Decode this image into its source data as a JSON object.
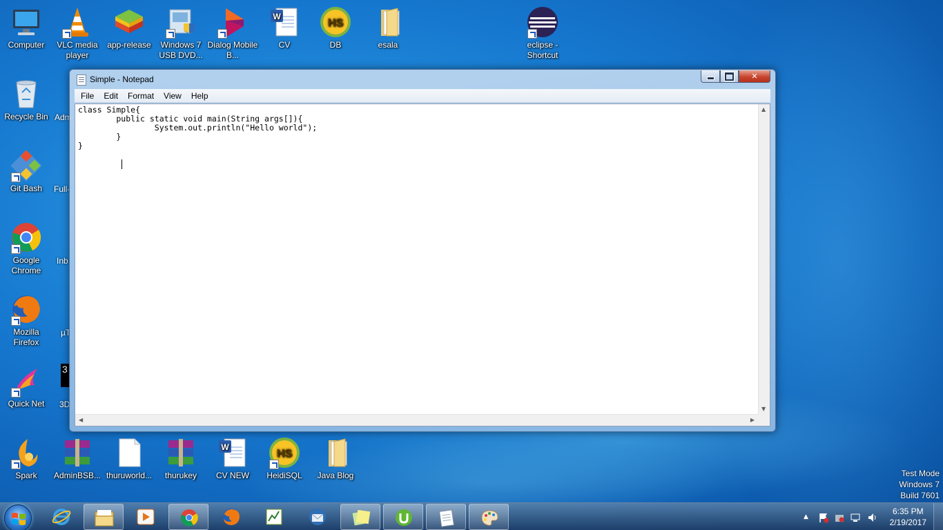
{
  "desktop_icons": [
    {
      "label": "Computer"
    },
    {
      "label": "VLC media player"
    },
    {
      "label": "app-release"
    },
    {
      "label": "Windows 7 USB DVD..."
    },
    {
      "label": "Dialog Mobile B..."
    },
    {
      "label": "CV"
    },
    {
      "label": "DB"
    },
    {
      "label": "esala"
    },
    {
      "label": "eclipse - Shortcut"
    },
    {
      "label": "Recycle Bin"
    },
    {
      "label": "Git Bash"
    },
    {
      "label": "Google Chrome"
    },
    {
      "label": "Mozilla Firefox"
    },
    {
      "label": "Quick Net"
    },
    {
      "label": "Spark"
    },
    {
      "label": "AdminBSB..."
    },
    {
      "label": "thuruworld..."
    },
    {
      "label": "thurukey"
    },
    {
      "label": "CV NEW"
    },
    {
      "label": "HeidiSQL"
    },
    {
      "label": "Java Blog"
    }
  ],
  "partial_labels": [
    "Adm",
    "Full-",
    "Inb",
    "µT",
    "3D",
    "3"
  ],
  "hs_badge": "HS",
  "notepad": {
    "title": "Simple - Notepad",
    "menu": [
      "File",
      "Edit",
      "Format",
      "View",
      "Help"
    ],
    "content": "class Simple{\n        public static void main(String args[]){\n                System.out.println(\"Hello world\");\n        }\n}"
  },
  "watermark": {
    "line1": "Test Mode",
    "line2": "Windows 7",
    "line3": "Build 7601"
  },
  "clock": {
    "time": "6:35 PM",
    "date": "2/19/2017"
  },
  "tray": {
    "expand_glyph": "▲"
  },
  "colors": {
    "desktop": "#1678cf",
    "close_button": "#c7452e"
  }
}
